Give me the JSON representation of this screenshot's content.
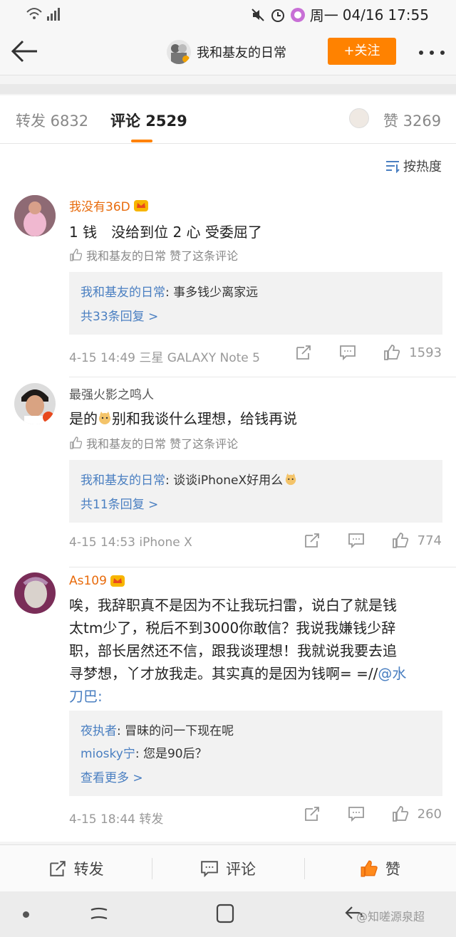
{
  "status_bar": {
    "day": "周一",
    "date": "04/16",
    "time": "17:55"
  },
  "nav": {
    "title": "我和基友的日常",
    "follow_label": "+关注"
  },
  "tabs": {
    "repost": "转发 6832",
    "comment": "评论 2529",
    "like": "赞 3269"
  },
  "sort_label": "按热度",
  "comments": [
    {
      "user": "我没有36D",
      "text": "1 钱　没给到位 2 心 受委屈了",
      "liked_by": "我和基友的日常 赞了这条评论",
      "replies": [
        {
          "who": "我和基友的日常",
          "text": ": 事多钱少离家远"
        }
      ],
      "more": "共33条回复 >",
      "meta": "4-15 14:49  三星 GALAXY Note 5",
      "likes": "1593"
    },
    {
      "user": "最强火影之鸣人",
      "text_before": "是的",
      "text_after": "别和我谈什么理想，给钱再说",
      "liked_by": "我和基友的日常 赞了这条评论",
      "replies": [
        {
          "who": "我和基友的日常",
          "text": ": 谈谈iPhoneX好用么"
        }
      ],
      "more": "共11条回复 >",
      "meta": "4-15 14:53  iPhone X",
      "likes": "774"
    },
    {
      "user": "As109",
      "text_lines": [
        "唉，我辞职真不是因为不让我玩扫雷，说白了就是钱",
        "太tm少了，税后不到3000你敢信？我说我嫌钱少辞",
        "职，部长居然还不信，跟我谈理想！我就说我要去追",
        "寻梦想，丫才放我走。其实真的是因为钱啊= =//"
      ],
      "mention_tail": "@水",
      "text_last": "刀巴:",
      "replies": [
        {
          "who": "夜执者",
          "text": ": 冒昧的问一下现在呢"
        },
        {
          "who": "miosky宁",
          "text": ": 您是90后？"
        }
      ],
      "more": "查看更多 >",
      "meta": "4-15 18:44  转发",
      "likes": "260"
    }
  ],
  "bottom_bar": {
    "repost": "转发",
    "comment": "评论",
    "like": "赞"
  },
  "watermark": "@知嗟源泉超"
}
